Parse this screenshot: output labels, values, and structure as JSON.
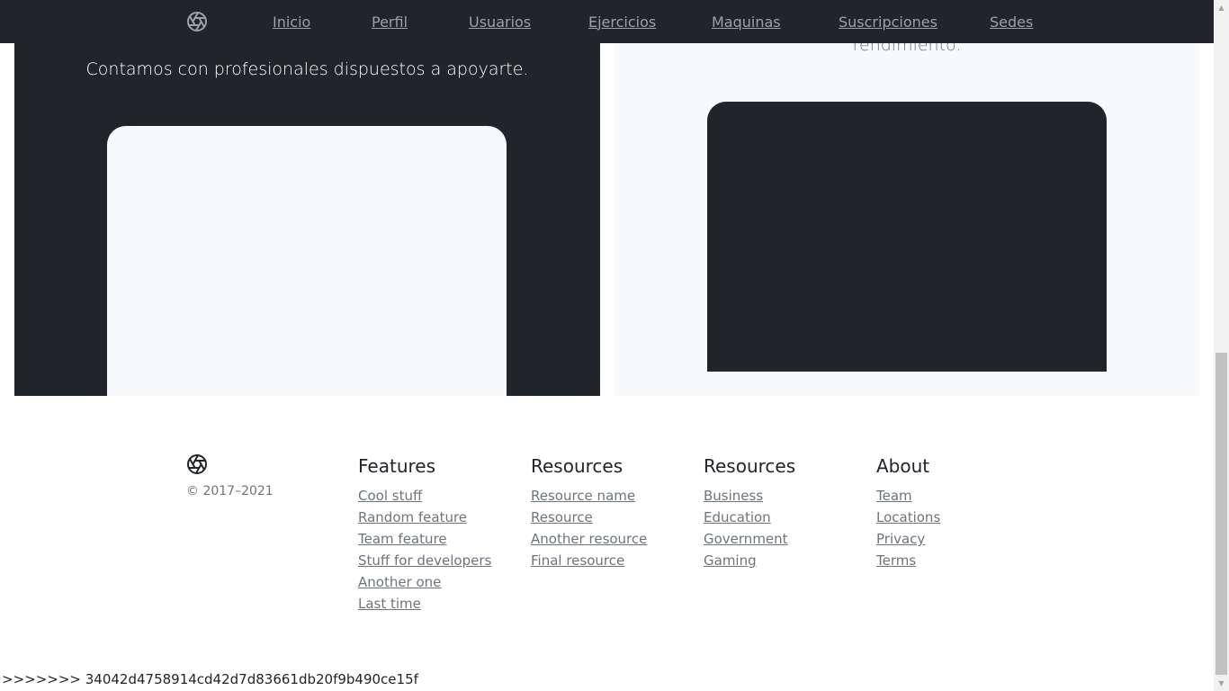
{
  "nav": {
    "logo_icon": "aperture-icon",
    "links": [
      "Inicio",
      "Perfil",
      "Usuarios",
      "Ejercicios",
      "Maquinas",
      "Suscripciones",
      "Sedes"
    ]
  },
  "hero": {
    "left_lead": "Contamos con profesionales dispuestos a apoyarte.",
    "right_lead": "rendimiento."
  },
  "footer": {
    "logo_icon": "aperture-icon",
    "copyright": "© 2017–2021",
    "columns": [
      {
        "title": "Features",
        "links": [
          "Cool stuff",
          "Random feature",
          "Team feature",
          "Stuff for developers",
          "Another one",
          "Last time"
        ]
      },
      {
        "title": "Resources",
        "links": [
          "Resource name",
          "Resource",
          "Another resource",
          "Final resource"
        ]
      },
      {
        "title": "Resources",
        "links": [
          "Business",
          "Education",
          "Government",
          "Gaming"
        ]
      },
      {
        "title": "About",
        "links": [
          "Team",
          "Locations",
          "Privacy",
          "Terms"
        ]
      }
    ]
  },
  "debug_line": ">>>>>>> 34042d4758914cd42d7d83661db20f9b490ce15f",
  "colors": {
    "dark": "#212529",
    "light": "#f8f9fa",
    "muted": "#6c757d"
  }
}
